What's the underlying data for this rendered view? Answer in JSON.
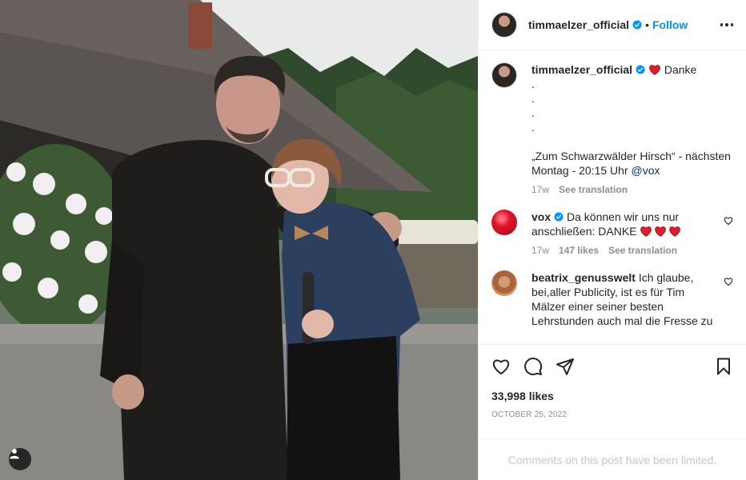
{
  "post": {
    "author": {
      "username": "timmaelzer_official",
      "avatar_icon": "profile-photo",
      "verified_icon": "verified-badge-icon"
    },
    "header": {
      "separator": "•",
      "follow_label": "Follow"
    },
    "caption": {
      "username": "timmaelzer_official",
      "emoji_icon": "red-heart-icon",
      "text": "Danke\n.\n.\n.\n.\n\n„Zum Schwarzwälder Hirsch“ - nächsten Montag - 20:15 Uhr ",
      "mention": "@vox",
      "age": "17w",
      "translate_label": "See translation"
    },
    "comments": [
      {
        "username": "vox",
        "text": "Da können wir uns nur anschließen: DANKE ",
        "hearts": [
          "red-heart-icon",
          "red-heart-icon",
          "red-heart-icon"
        ],
        "age": "17w",
        "likes": "147 likes",
        "translate_label": "See translation"
      },
      {
        "username": "beatrix_genusswelt",
        "text": "Ich glaube, bei,aller Publicity, ist es für Tim Mälzer einer seiner besten Lehrstunden auch mal die Fresse zu"
      }
    ],
    "likes_count": "33,998 likes",
    "date": "OCTOBER 25, 2022",
    "comments_limited": "Comments on this post have been limited.",
    "colors": {
      "accent": "#0095f6",
      "verified": "#0095f6",
      "heart": "#ed4956",
      "text": "#262626",
      "muted": "#8e8e8e"
    }
  }
}
